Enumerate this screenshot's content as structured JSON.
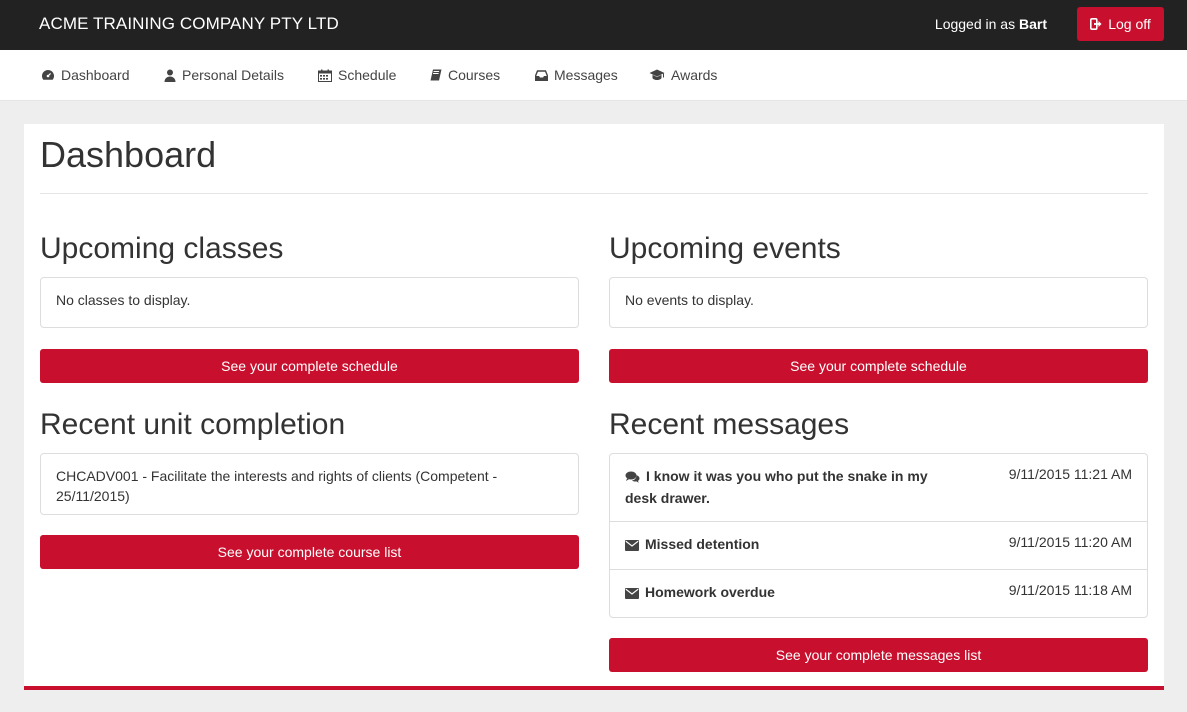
{
  "header": {
    "brand": "ACME TRAINING COMPANY PTY LTD",
    "logged_in_prefix": "Logged in as",
    "user": "Bart",
    "logoff_label": "Log off"
  },
  "nav": {
    "dashboard": "Dashboard",
    "personal": "Personal Details",
    "schedule": "Schedule",
    "courses": "Courses",
    "messages": "Messages",
    "awards": "Awards"
  },
  "main": {
    "title": "Dashboard",
    "upcoming_classes": {
      "heading": "Upcoming classes",
      "text": "No classes to display.",
      "button": "See your complete schedule"
    },
    "upcoming_events": {
      "heading": "Upcoming events",
      "text": "No events to display.",
      "button": "See your complete schedule"
    },
    "recent_units": {
      "heading": "Recent unit completion",
      "text": "CHCADV001 - Facilitate the interests and rights of clients (Competent - 25/11/2015)",
      "button": "See your complete course list"
    },
    "recent_messages": {
      "heading": "Recent messages",
      "items": [
        {
          "icon": "comments-icon",
          "subject": "I know it was you who put the snake in my desk drawer.",
          "date": "9/11/2015 11:21 AM"
        },
        {
          "icon": "envelope-icon",
          "subject": "Missed detention",
          "date": "9/11/2015 11:20 AM"
        },
        {
          "icon": "envelope-icon",
          "subject": "Homework overdue",
          "date": "9/11/2015 11:18 AM"
        }
      ],
      "button": "See your complete messages list"
    }
  },
  "colors": {
    "accent": "#c8102e",
    "topbar": "#222222",
    "background": "#eeeeee"
  }
}
